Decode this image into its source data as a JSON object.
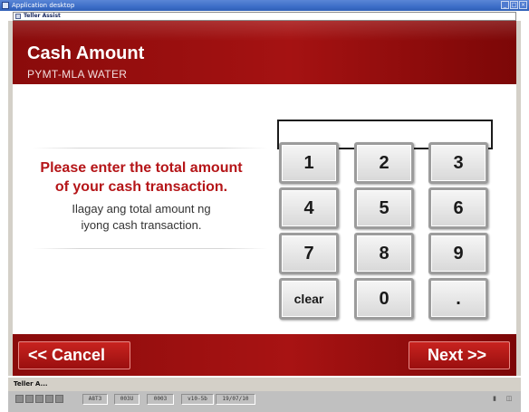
{
  "window": {
    "title": "Application desktop",
    "minimize_glyph": "_",
    "maximize_glyph": "□",
    "close_glyph": "×"
  },
  "inner_window": {
    "title": "Teller Assist"
  },
  "header": {
    "title": "Cash Amount",
    "subtitle": "PYMT-MLA WATER"
  },
  "prompt": {
    "english_line1": "Please enter the total amount",
    "english_line2": "of your cash transaction.",
    "tagalog_line1": "Ilagay ang total amount ng",
    "tagalog_line2": "iyong cash transaction."
  },
  "amount_input": {
    "value": ""
  },
  "keypad": {
    "keys": [
      "1",
      "2",
      "3",
      "4",
      "5",
      "6",
      "7",
      "8",
      "9",
      "clear",
      "0",
      "."
    ]
  },
  "footer": {
    "cancel_label": "<< Cancel",
    "next_label": "Next  >>"
  },
  "taskbar": {
    "item_label": "Teller A..."
  },
  "status": {
    "cells": [
      "A8T3",
      "003U",
      "0003",
      "v10-5b",
      "19/07/10"
    ]
  },
  "colors": {
    "brand_red": "#a51212",
    "prompt_red": "#b51518",
    "title_bar_blue": "#3d6ec8"
  }
}
